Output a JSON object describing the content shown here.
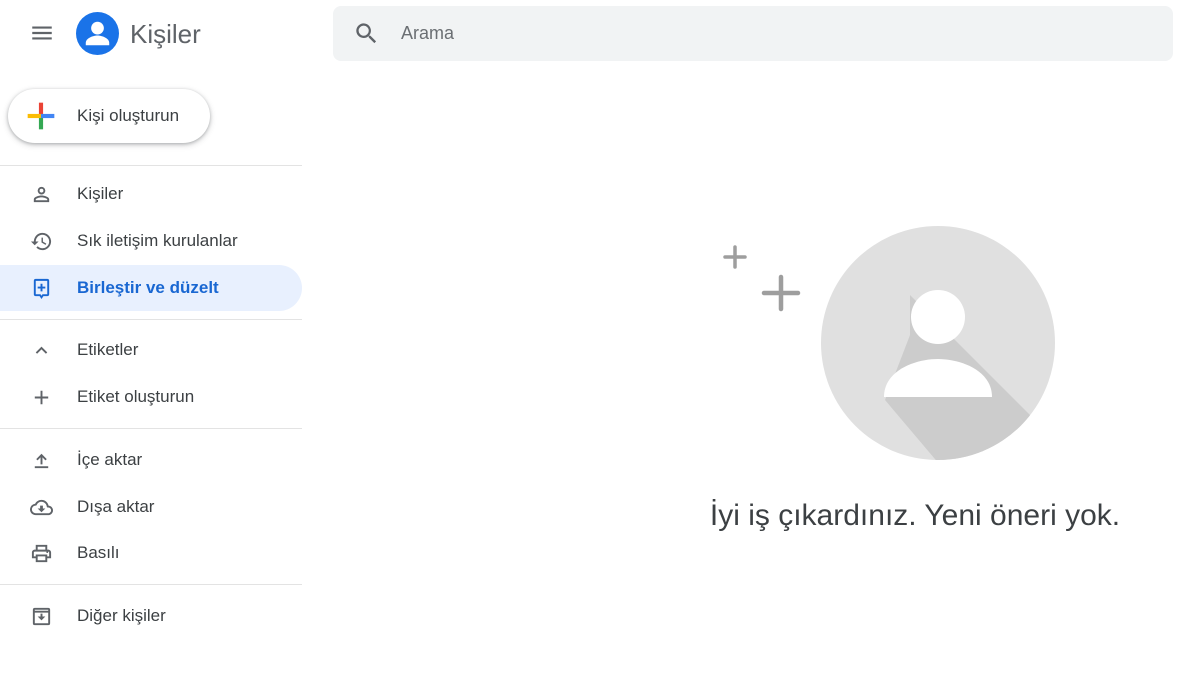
{
  "header": {
    "app_title": "Kişiler",
    "search_placeholder": "Arama"
  },
  "sidebar": {
    "create_label": "Kişi oluşturun",
    "items": [
      {
        "label": "Kişiler",
        "icon": "person-icon"
      },
      {
        "label": "Sık iletişim kurulanlar",
        "icon": "history-icon"
      },
      {
        "label": "Birleştir ve düzelt",
        "icon": "merge-icon",
        "active": true
      }
    ],
    "labels_section": {
      "title": "Etiketler",
      "create_label": "Etiket oluşturun"
    },
    "tools": [
      {
        "label": "İçe aktar",
        "icon": "upload-icon"
      },
      {
        "label": "Dışa aktar",
        "icon": "cloud-download-icon"
      },
      {
        "label": "Basılı",
        "icon": "print-icon"
      }
    ],
    "other": {
      "label": "Diğer kişiler",
      "icon": "archive-icon"
    }
  },
  "main": {
    "empty_message": "İyi iş çıkardınız. Yeni öneri yok."
  },
  "colors": {
    "accent": "#1967d2",
    "active_bg": "#e8f0fe",
    "search_bg": "#f1f3f4",
    "logo_blue": "#1a73e8",
    "illustration_gray": "#e0e0e0"
  }
}
